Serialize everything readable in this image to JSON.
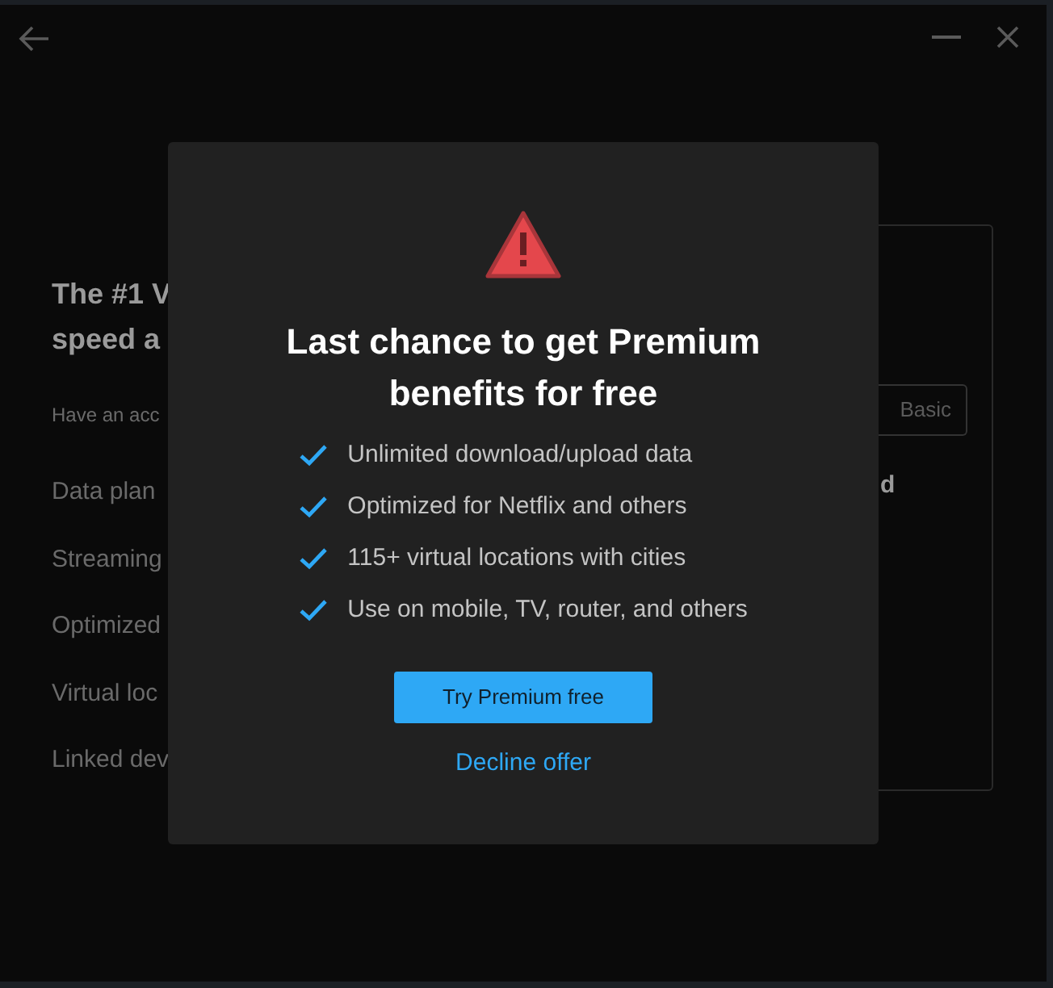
{
  "background": {
    "headline_lines": [
      "The #1 V",
      "speed a"
    ],
    "subtitle": "Have an acc",
    "features": [
      "Data plan",
      "Streaming",
      "Optimized",
      "Virtual loc",
      "Linked dev"
    ],
    "plan_button": "Basic",
    "card_text": "d"
  },
  "dialog": {
    "title": "Last chance to get Premium benefits for free",
    "benefits": [
      "Unlimited download/upload data",
      "Optimized for Netflix and others",
      "115+ virtual locations with cities",
      "Use on mobile, TV, router, and others"
    ],
    "primary_button": "Try Premium free",
    "decline_link": "Decline offer"
  }
}
